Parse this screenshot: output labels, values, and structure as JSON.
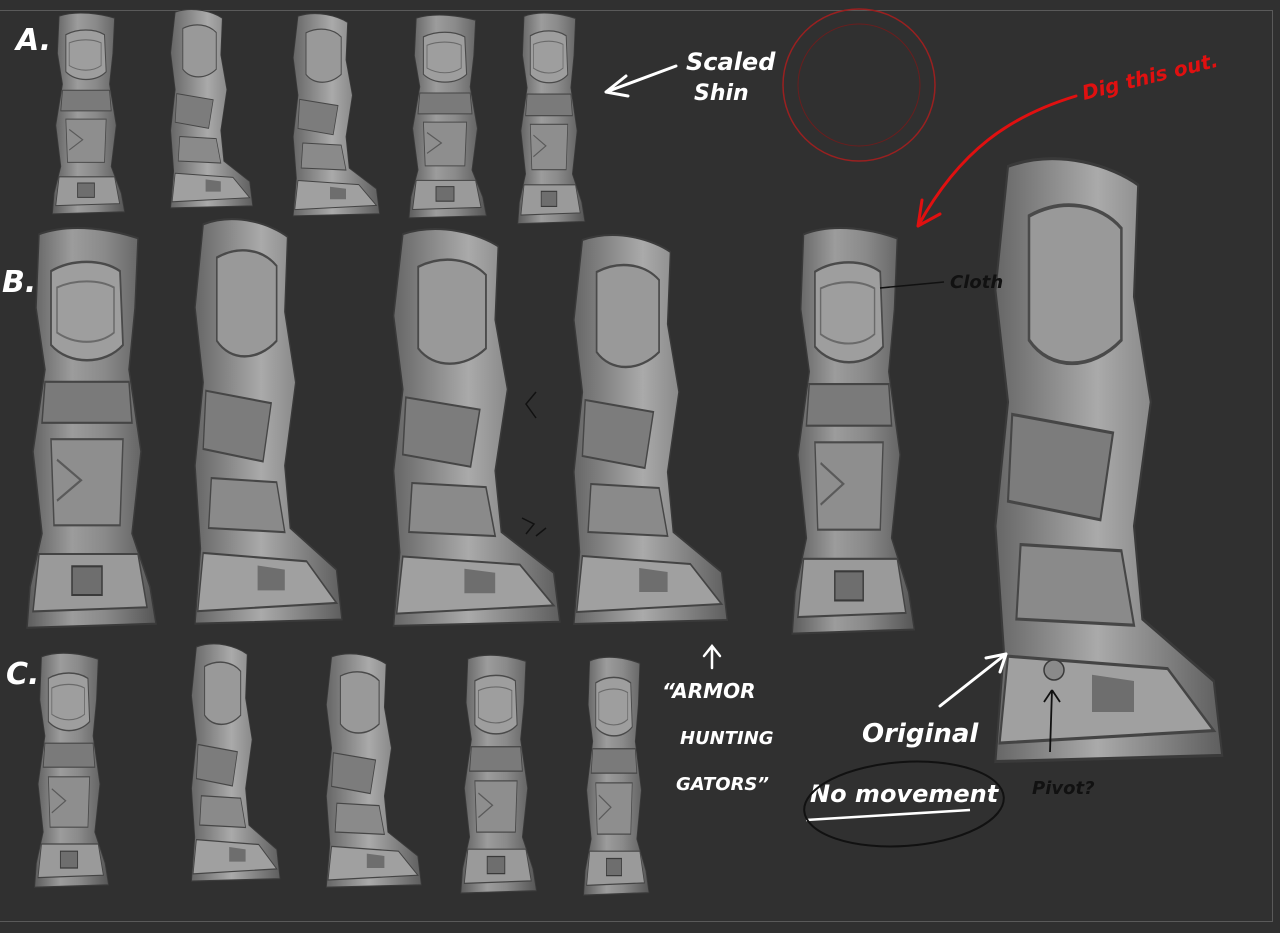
{
  "sheet": {
    "rows": [
      {
        "label": "A."
      },
      {
        "label": "B."
      },
      {
        "label": "C."
      }
    ],
    "annotations": {
      "scaled_shin": [
        "Scaled",
        "Shin"
      ],
      "armor_hunting_gators": [
        "“ARMOR",
        "HUNTING",
        "GATORS”"
      ],
      "original": "Original",
      "no_movement": "No movement",
      "pivot": "Pivot?",
      "cloth": "Cloth",
      "dig_this_out": "Dig this out."
    },
    "colors": {
      "background": "#303030",
      "sculpt": "#8c8c8c",
      "ink_white": "#ffffff",
      "ink_black": "#111111",
      "ink_red": "#e01010",
      "brush_ring": "#9a2020"
    },
    "icons": [
      "brush-cursor-icon",
      "arrow-icon"
    ]
  }
}
